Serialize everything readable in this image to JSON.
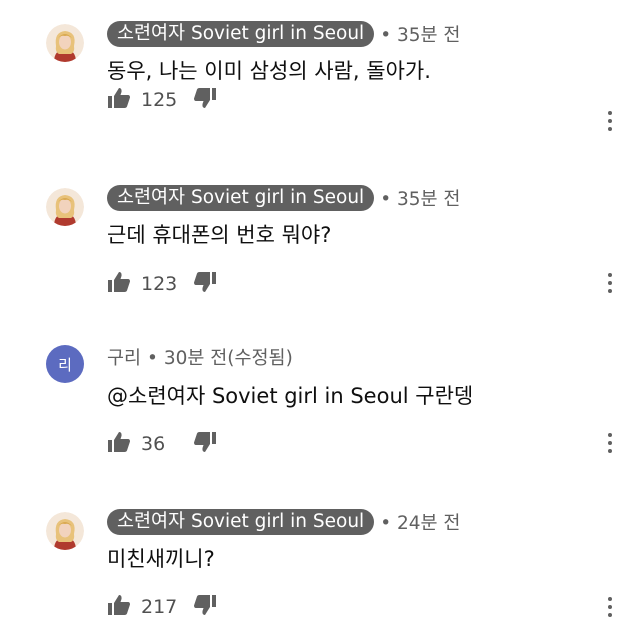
{
  "comments": [
    {
      "author": "소련여자 Soviet girl in Seoul",
      "author_style": "chip",
      "time": "• 35분 전",
      "text": "동우, 나는 이미 삼성의 사람, 돌아가.",
      "likes": "125"
    },
    {
      "author": "소련여자 Soviet girl in Seoul",
      "author_style": "chip",
      "time": "• 35분 전",
      "text": "근데 휴대폰의 번호 뭐야?",
      "likes": "123"
    },
    {
      "author": "구리",
      "author_style": "plain",
      "avatar_letter": "리",
      "time": "• 30분 전(수정됨)",
      "text": "@소련여자 Soviet girl in Seoul 구란뎅",
      "likes": "36"
    },
    {
      "author": "소련여자 Soviet girl in Seoul",
      "author_style": "chip",
      "time": "• 24분 전",
      "text": "미친새끼니?",
      "likes": "217"
    }
  ],
  "colors": {
    "author_chip_bg": "#606060",
    "letter_avatar_bg": "#5c6bc0",
    "secondary_text": "#606060",
    "primary_text": "#0f0f0f"
  },
  "icons": {
    "like": "thumbs-up-icon",
    "dislike": "thumbs-down-icon",
    "menu": "more-vertical-icon"
  }
}
